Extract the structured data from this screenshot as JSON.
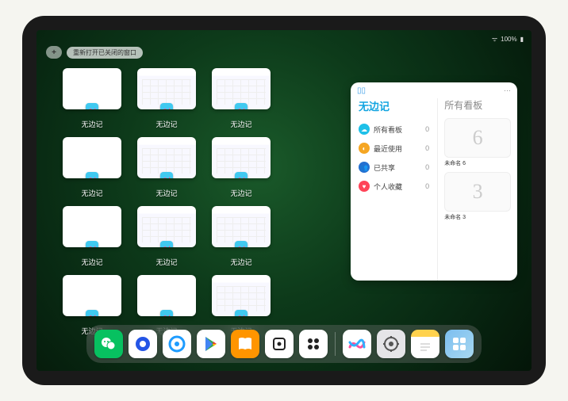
{
  "statusbar": {
    "time": "",
    "battery": "100%"
  },
  "topbar": {
    "plus": "+",
    "reopen": "重新打开已关闭的窗口"
  },
  "windows": [
    {
      "label": "无边记",
      "style": "blank"
    },
    {
      "label": "无边记",
      "style": "calendar"
    },
    {
      "label": "无边记",
      "style": "calendar"
    },
    {
      "label": "",
      "style": "empty"
    },
    {
      "label": "无边记",
      "style": "blank"
    },
    {
      "label": "无边记",
      "style": "calendar"
    },
    {
      "label": "无边记",
      "style": "calendar"
    },
    {
      "label": "",
      "style": "empty"
    },
    {
      "label": "无边记",
      "style": "blank"
    },
    {
      "label": "无边记",
      "style": "calendar"
    },
    {
      "label": "无边记",
      "style": "calendar"
    },
    {
      "label": "",
      "style": "empty"
    },
    {
      "label": "无边记",
      "style": "blank"
    },
    {
      "label": "无边记",
      "style": "blank"
    },
    {
      "label": "无边记",
      "style": "calendar"
    }
  ],
  "panel": {
    "sidebar_title": "无边记",
    "content_title": "所有看板",
    "more": "···",
    "items": [
      {
        "icon": "cloud",
        "label": "所有看板",
        "count": "0"
      },
      {
        "icon": "clock",
        "label": "最近使用",
        "count": "0"
      },
      {
        "icon": "people",
        "label": "已共享",
        "count": "0"
      },
      {
        "icon": "heart",
        "label": "个人收藏",
        "count": "0"
      }
    ],
    "boards": [
      {
        "glyph": "6",
        "title": "未命名 6",
        "sub": ""
      },
      {
        "glyph": "3",
        "title": "未命名 3",
        "sub": ""
      }
    ]
  },
  "dock": {
    "icons": [
      {
        "name": "wechat",
        "class": "di-wechat"
      },
      {
        "name": "quark",
        "class": "di-quark"
      },
      {
        "name": "qqbrowser",
        "class": "di-qq"
      },
      {
        "name": "playstore",
        "class": "di-play"
      },
      {
        "name": "books",
        "class": "di-books"
      },
      {
        "name": "obsidian",
        "class": "di-obs"
      },
      {
        "name": "camera-app",
        "class": "di-cam"
      }
    ],
    "recent": [
      {
        "name": "freeform",
        "class": "di-freeform"
      },
      {
        "name": "settings",
        "class": "di-settings"
      },
      {
        "name": "notes",
        "class": "di-notes"
      },
      {
        "name": "app-library",
        "class": "di-library"
      }
    ]
  }
}
